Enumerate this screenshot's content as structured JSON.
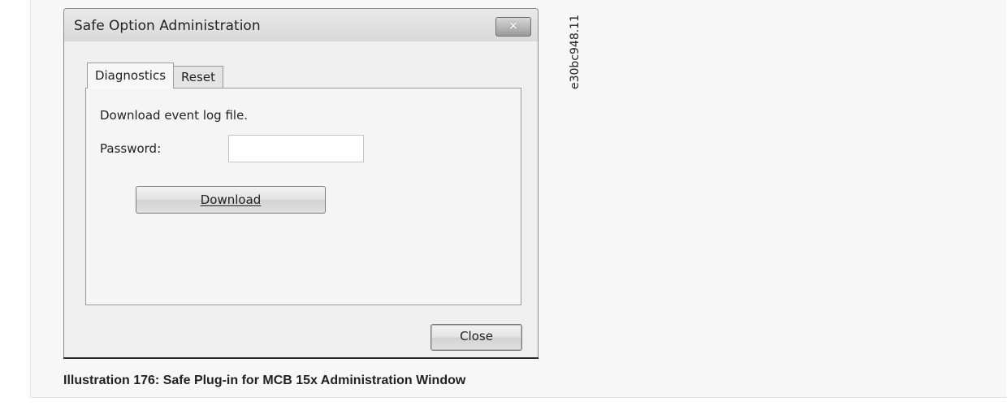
{
  "window": {
    "title": "Safe Option Administration",
    "close_glyph": "✕"
  },
  "tabs": [
    {
      "label": "Diagnostics",
      "selected": true
    },
    {
      "label": "Reset",
      "selected": false
    }
  ],
  "diagnostics": {
    "description": "Download event log file.",
    "password_label": "Password:",
    "password_value": "",
    "download_label": "Download"
  },
  "footer": {
    "close_label": "Close"
  },
  "figure": {
    "side_id": "e30bc948.11",
    "caption": "Illustration 176: Safe Plug-in for MCB 15x Administration Window"
  }
}
